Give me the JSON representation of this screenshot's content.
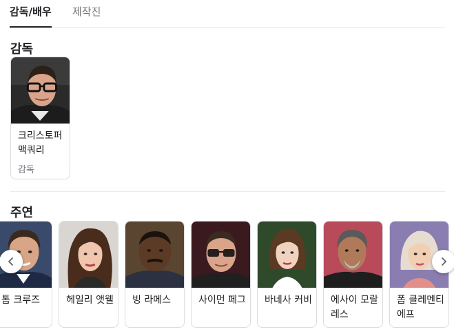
{
  "tabs": [
    {
      "label": "감독/배우",
      "active": true
    },
    {
      "label": "제작진",
      "active": false
    }
  ],
  "director_section": {
    "title": "감독",
    "people": [
      {
        "name": "크리스토퍼 맥쿼리",
        "role": "감독"
      }
    ]
  },
  "cast_section": {
    "title": "주연",
    "people": [
      {
        "name": "톰 크루즈"
      },
      {
        "name": "헤일리 앳웰"
      },
      {
        "name": "빙 라메스"
      },
      {
        "name": "사이먼 페그"
      },
      {
        "name": "바네사 커비"
      },
      {
        "name": "에사이 모랄레스"
      },
      {
        "name": "폼 클레멘티에프"
      }
    ]
  },
  "navigation": {
    "prev_icon": "chevron-left-icon",
    "next_icon": "chevron-right-icon"
  },
  "colors": {
    "active_tab": "#202124",
    "inactive_tab": "#70757a",
    "border": "#dadce0",
    "divider": "#ebebeb"
  }
}
